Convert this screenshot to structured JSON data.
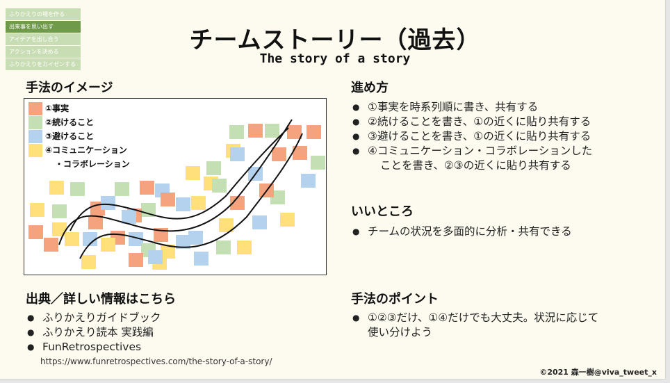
{
  "nav": {
    "items": [
      {
        "label": "ふりかえりの場を作る",
        "active": false
      },
      {
        "label": "出来事を思い出す",
        "active": true
      },
      {
        "label": "アイデアを出し合う",
        "active": false
      },
      {
        "label": "アクションを決める",
        "active": false
      },
      {
        "label": "ふりかえりをカイゼンする",
        "active": false
      }
    ]
  },
  "title": "チームストーリー（過去）",
  "subtitle": "The story of a story",
  "image_section": {
    "heading": "手法のイメージ",
    "legend": [
      {
        "label": "①事実",
        "color": "#f4a37e"
      },
      {
        "label": "②続けること",
        "color": "#c4dfb4"
      },
      {
        "label": "③避けること",
        "color": "#b4d1ee"
      },
      {
        "label": "④コミュニケーション",
        "color": "#ffe07b"
      }
    ],
    "legend_continuation": "・コラボレーション"
  },
  "steps": {
    "heading": "進め方",
    "items": [
      "①事実を時系列順に書き、共有する",
      "②続けることを書き、①の近くに貼り共有する",
      "③避けることを書き、①の近くに貼り共有する",
      "④コミュニケーション・コラボレーションしたことを書き、②③の近くに貼り共有する"
    ],
    "item4_line1": "④コミュニケーション・コラボレーションした",
    "item4_line2": "ことを書き、②③の近くに貼り共有する"
  },
  "good": {
    "heading": "いいところ",
    "items": [
      "チームの状況を多面的に分析・共有できる"
    ]
  },
  "sources": {
    "heading": "出典／詳しい情報はこちら",
    "items": [
      "ふりかえりガイドブック",
      "ふりかえり読本 実践編",
      "FunRetrospectives"
    ],
    "url": "https://www.funretrospectives.com/the-story-of-a-story/"
  },
  "points": {
    "heading": "手法のポイント",
    "line1": "①②③だけ、①④だけでも大丈夫。状況に応じて",
    "line2": "使い分けよう"
  },
  "credit": "©2021 森一樹@viva_tweet_x",
  "colors": {
    "fact": "#f4a37e",
    "keep": "#c4dfb4",
    "avoid": "#b4d1ee",
    "communication": "#ffe07b",
    "nav_active": "#6f9a49",
    "nav_inactive": "#c9ddb4"
  }
}
